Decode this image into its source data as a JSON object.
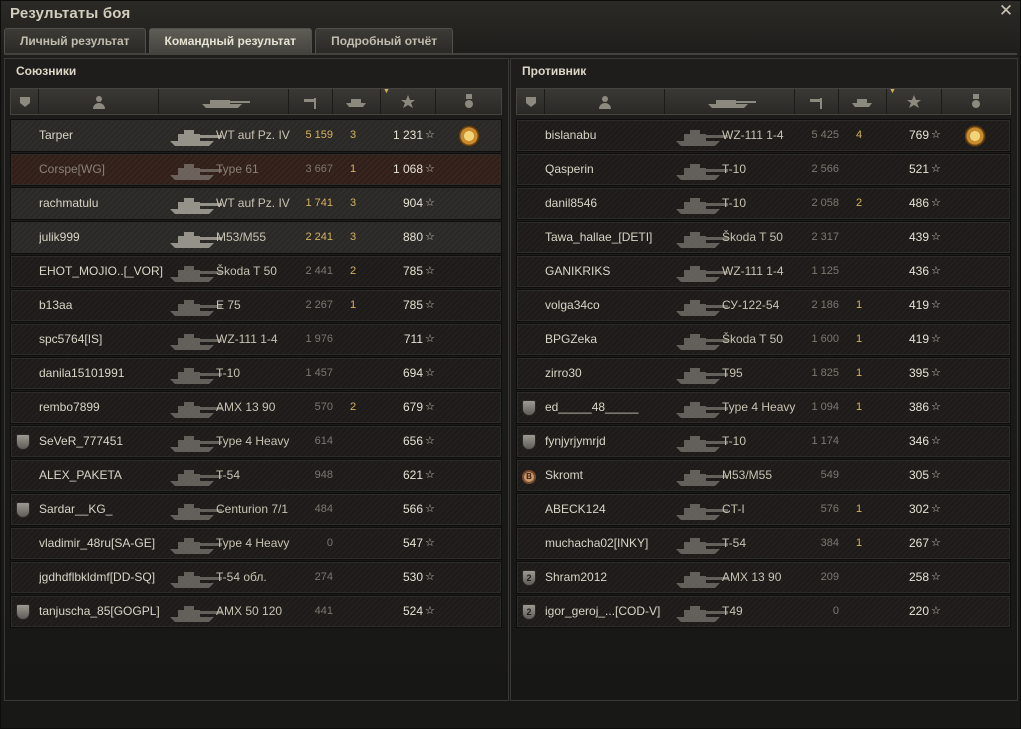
{
  "window": {
    "title": "Результаты боя",
    "close_glyph": "✕"
  },
  "tabs": [
    {
      "label": "Личный результат",
      "active": false
    },
    {
      "label": "Командный результат",
      "active": true
    },
    {
      "label": "Подробный отчёт",
      "active": false
    }
  ],
  "allies": {
    "title": "Союзники",
    "rows": [
      {
        "player": "Tarper",
        "tank": "WT auf Pz. IV",
        "damage": "5 159",
        "kills": "3",
        "xp": "1 231",
        "badge": "",
        "medal": true,
        "style": "self",
        "dmg_hi": true
      },
      {
        "player": "Corspe[WG]",
        "tank": "Type 61",
        "damage": "3 667",
        "kills": "1",
        "xp": "1 068",
        "badge": "",
        "medal": false,
        "style": "dead",
        "dmg_hi": false
      },
      {
        "player": "rachmatulu",
        "tank": "WT auf Pz. IV",
        "damage": "1 741",
        "kills": "3",
        "xp": "904",
        "badge": "",
        "medal": false,
        "style": "self",
        "dmg_hi": true
      },
      {
        "player": "julik999",
        "tank": "M53/M55",
        "damage": "2 241",
        "kills": "3",
        "xp": "880",
        "badge": "",
        "medal": false,
        "style": "self",
        "dmg_hi": true
      },
      {
        "player": "EHOT_MOJIO..[_VOR]",
        "tank": "Škoda T 50",
        "damage": "2 441",
        "kills": "2",
        "xp": "785",
        "badge": "",
        "medal": false,
        "style": "",
        "dmg_hi": false
      },
      {
        "player": "b13aa",
        "tank": "E 75",
        "damage": "2 267",
        "kills": "1",
        "xp": "785",
        "badge": "",
        "medal": false,
        "style": "",
        "dmg_hi": false
      },
      {
        "player": "spc5764[IS]",
        "tank": "WZ-111 1-4",
        "damage": "1 976",
        "kills": "",
        "xp": "711",
        "badge": "",
        "medal": false,
        "style": "",
        "dmg_hi": false
      },
      {
        "player": "danila15101991",
        "tank": "T-10",
        "damage": "1 457",
        "kills": "",
        "xp": "694",
        "badge": "",
        "medal": false,
        "style": "",
        "dmg_hi": false
      },
      {
        "player": "rembo7899",
        "tank": "AMX 13 90",
        "damage": "570",
        "kills": "2",
        "xp": "679",
        "badge": "",
        "medal": false,
        "style": "",
        "dmg_hi": false
      },
      {
        "player": "SeVeR_777451",
        "tank": "Type 4 Heavy",
        "damage": "614",
        "kills": "",
        "xp": "656",
        "badge": "shield",
        "medal": false,
        "style": "",
        "dmg_hi": false
      },
      {
        "player": "ALEX_PAKETA",
        "tank": "T-54",
        "damage": "948",
        "kills": "",
        "xp": "621",
        "badge": "",
        "medal": false,
        "style": "",
        "dmg_hi": false
      },
      {
        "player": "Sardar__KG_",
        "tank": "Centurion 7/1",
        "damage": "484",
        "kills": "",
        "xp": "566",
        "badge": "shield",
        "medal": false,
        "style": "",
        "dmg_hi": false
      },
      {
        "player": "vladimir_48ru[SA-GE]",
        "tank": "Type 4 Heavy",
        "damage": "0",
        "kills": "",
        "xp": "547",
        "badge": "",
        "medal": false,
        "style": "",
        "dmg_hi": false
      },
      {
        "player": "jgdhdflbkldmf[DD-SQ]",
        "tank": "T-54 обл.",
        "damage": "274",
        "kills": "",
        "xp": "530",
        "badge": "",
        "medal": false,
        "style": "",
        "dmg_hi": false
      },
      {
        "player": "tanjuscha_85[GOGPL]",
        "tank": "AMX 50 120",
        "damage": "441",
        "kills": "",
        "xp": "524",
        "badge": "shield",
        "medal": false,
        "style": "",
        "dmg_hi": false
      }
    ]
  },
  "enemies": {
    "title": "Противник",
    "rows": [
      {
        "player": "bislanabu",
        "tank": "WZ-111 1-4",
        "damage": "5 425",
        "kills": "4",
        "xp": "769",
        "badge": "",
        "medal": true,
        "style": "",
        "dmg_hi": false
      },
      {
        "player": "Qasperin",
        "tank": "T-10",
        "damage": "2 566",
        "kills": "",
        "xp": "521",
        "badge": "",
        "medal": false,
        "style": "",
        "dmg_hi": false
      },
      {
        "player": "danil8546",
        "tank": "T-10",
        "damage": "2 058",
        "kills": "2",
        "xp": "486",
        "badge": "",
        "medal": false,
        "style": "",
        "dmg_hi": false
      },
      {
        "player": "Tawa_hallae_[DETI]",
        "tank": "Škoda T 50",
        "damage": "2 317",
        "kills": "",
        "xp": "439",
        "badge": "",
        "medal": false,
        "style": "",
        "dmg_hi": false
      },
      {
        "player": "GANIKRIKS",
        "tank": "WZ-111 1-4",
        "damage": "1 125",
        "kills": "",
        "xp": "436",
        "badge": "",
        "medal": false,
        "style": "",
        "dmg_hi": false
      },
      {
        "player": "volga34co",
        "tank": "СУ-122-54",
        "damage": "2 186",
        "kills": "1",
        "xp": "419",
        "badge": "",
        "medal": false,
        "style": "",
        "dmg_hi": false
      },
      {
        "player": "BPGZeka",
        "tank": "Škoda T 50",
        "damage": "1 600",
        "kills": "1",
        "xp": "419",
        "badge": "",
        "medal": false,
        "style": "",
        "dmg_hi": false
      },
      {
        "player": "zirro30",
        "tank": "T95",
        "damage": "1 825",
        "kills": "1",
        "xp": "395",
        "badge": "",
        "medal": false,
        "style": "",
        "dmg_hi": false
      },
      {
        "player": "ed_____48_____",
        "tank": "Type 4 Heavy",
        "damage": "1 094",
        "kills": "1",
        "xp": "386",
        "badge": "shield",
        "medal": false,
        "style": "",
        "dmg_hi": false
      },
      {
        "player": "fynjyrjymrjd",
        "tank": "T-10",
        "damage": "1 174",
        "kills": "",
        "xp": "346",
        "badge": "shield",
        "medal": false,
        "style": "",
        "dmg_hi": false
      },
      {
        "player": "Skromt",
        "tank": "M53/M55",
        "damage": "549",
        "kills": "",
        "xp": "305",
        "badge": "clan",
        "medal": false,
        "style": "",
        "dmg_hi": false
      },
      {
        "player": "ABECK124",
        "tank": "CT-I",
        "damage": "576",
        "kills": "1",
        "xp": "302",
        "badge": "",
        "medal": false,
        "style": "",
        "dmg_hi": false
      },
      {
        "player": "muchacha02[INKY]",
        "tank": "T-54",
        "damage": "384",
        "kills": "1",
        "xp": "267",
        "badge": "",
        "medal": false,
        "style": "",
        "dmg_hi": false
      },
      {
        "player": "Shram2012",
        "tank": "AMX 13 90",
        "damage": "209",
        "kills": "",
        "xp": "258",
        "badge": "rank2",
        "medal": false,
        "style": "",
        "dmg_hi": false
      },
      {
        "player": "igor_geroj_...[COD-V]",
        "tank": "T49",
        "damage": "0",
        "kills": "",
        "xp": "220",
        "badge": "rank2",
        "medal": false,
        "style": "",
        "dmg_hi": false
      }
    ]
  },
  "icons": {
    "header": [
      "rank-icon",
      "player-icon",
      "tank-icon",
      "damage-icon",
      "kills-icon",
      "xp-star-icon",
      "medal-icon"
    ],
    "star_glyph": "☆",
    "rank2_glyph": "2",
    "clan_glyph": "B"
  },
  "colors": {
    "damage_highlight": "#d6b25f",
    "kills": "#d6b25f",
    "dead_row": "#3a241e"
  }
}
